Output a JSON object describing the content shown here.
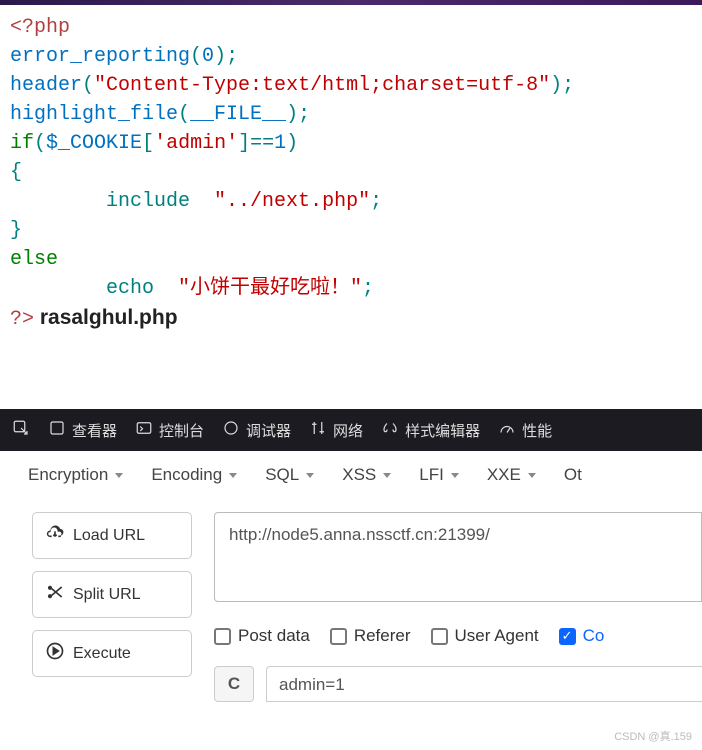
{
  "code": {
    "open": "<?php",
    "l2a": "error_reporting",
    "l2b": "(",
    "l2c": "0",
    "l2d": ");",
    "l3a": "header",
    "l3b": "(",
    "l3c": "\"Content-Type:text/html;charset=utf-8\"",
    "l3d": ");",
    "l4a": "highlight_file",
    "l4b": "(",
    "l4c": "__FILE__",
    "l4d": ");",
    "l5a": "if",
    "l5b": "(",
    "l5c": "$_COOKIE",
    "l5d": "[",
    "l5e": "'admin'",
    "l5f": "]==",
    "l5g": "1",
    "l5h": ")",
    "l6": "{",
    "l7a": "        include  ",
    "l7b": "\"../next.php\"",
    "l7c": ";",
    "l8": "}",
    "l9": "else",
    "l10a": "        echo  ",
    "l10b": "\"小饼干最好吃啦！\"",
    "l10c": ";",
    "close": "?>",
    "extra": " rasalghul.php"
  },
  "devtools": {
    "inspector": "查看器",
    "console": "控制台",
    "debugger": "调试器",
    "network": "网络",
    "style": "样式编辑器",
    "perf": "性能"
  },
  "toolbar": {
    "enc": "Encryption",
    "encoding": "Encoding",
    "sql": "SQL",
    "xss": "XSS",
    "lfi": "LFI",
    "xxe": "XXE",
    "other": "Ot"
  },
  "buttons": {
    "load": "Load URL",
    "split": "Split URL",
    "exec": "Execute"
  },
  "url": "http://node5.anna.nssctf.cn:21399/",
  "checks": {
    "post": "Post data",
    "referer": "Referer",
    "ua": "User Agent",
    "cookie": "Co"
  },
  "cookie_btn": "C",
  "cookie_value": "admin=1",
  "watermark": "CSDN @真.159"
}
